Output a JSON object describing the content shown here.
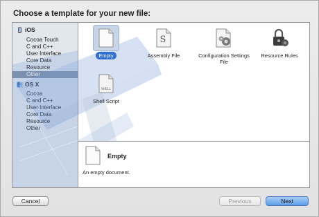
{
  "dialog": {
    "title": "Choose a template for your new file:"
  },
  "sidebar": {
    "sections": [
      {
        "header": "iOS",
        "items": [
          "Cocoa Touch",
          "C and C++",
          "User Interface",
          "Core Data",
          "Resource",
          "Other"
        ]
      },
      {
        "header": "OS X",
        "items": [
          "Cocoa",
          "C and C++",
          "User Interface",
          "Core Data",
          "Resource",
          "Other"
        ]
      }
    ],
    "selected": "iOS / Other"
  },
  "templates": [
    {
      "label": "Empty",
      "icon": "empty-document-icon",
      "selected": true
    },
    {
      "label": "Assembly File",
      "icon": "assembly-file-icon"
    },
    {
      "label": "Configuration Settings File",
      "icon": "configuration-settings-icon"
    },
    {
      "label": "Resource Rules",
      "icon": "resource-rules-icon"
    },
    {
      "label": "Shell Script",
      "icon": "shell-script-icon",
      "badge": "SHELL"
    }
  ],
  "description": {
    "title": "Empty",
    "text": "An empty document."
  },
  "buttons": {
    "cancel": "Cancel",
    "previous": "Previous",
    "next": "Next"
  },
  "colors": {
    "selection": "#2f6ed2",
    "sidebar_selection": "#8595ab",
    "primary_button": "#5b9de9"
  }
}
